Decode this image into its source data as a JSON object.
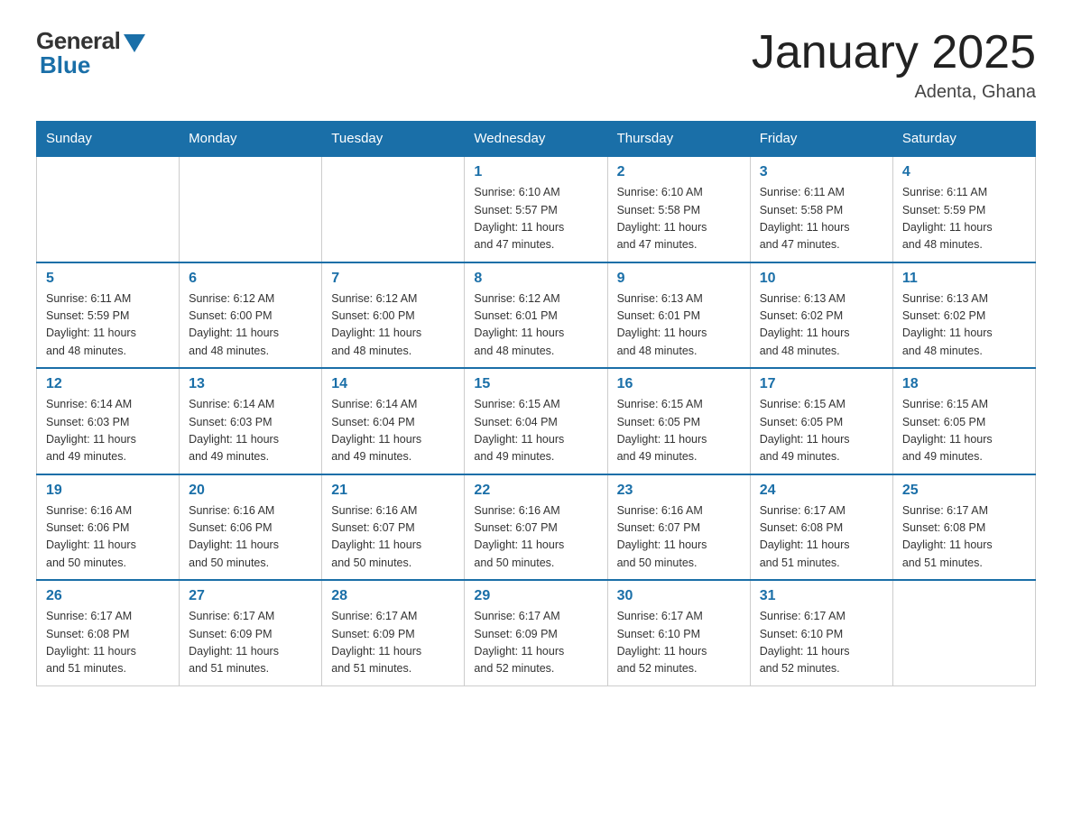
{
  "header": {
    "logo_general": "General",
    "logo_blue": "Blue",
    "month_title": "January 2025",
    "location": "Adenta, Ghana"
  },
  "weekdays": [
    "Sunday",
    "Monday",
    "Tuesday",
    "Wednesday",
    "Thursday",
    "Friday",
    "Saturday"
  ],
  "weeks": [
    [
      {
        "day": "",
        "info": ""
      },
      {
        "day": "",
        "info": ""
      },
      {
        "day": "",
        "info": ""
      },
      {
        "day": "1",
        "info": "Sunrise: 6:10 AM\nSunset: 5:57 PM\nDaylight: 11 hours\nand 47 minutes."
      },
      {
        "day": "2",
        "info": "Sunrise: 6:10 AM\nSunset: 5:58 PM\nDaylight: 11 hours\nand 47 minutes."
      },
      {
        "day": "3",
        "info": "Sunrise: 6:11 AM\nSunset: 5:58 PM\nDaylight: 11 hours\nand 47 minutes."
      },
      {
        "day": "4",
        "info": "Sunrise: 6:11 AM\nSunset: 5:59 PM\nDaylight: 11 hours\nand 48 minutes."
      }
    ],
    [
      {
        "day": "5",
        "info": "Sunrise: 6:11 AM\nSunset: 5:59 PM\nDaylight: 11 hours\nand 48 minutes."
      },
      {
        "day": "6",
        "info": "Sunrise: 6:12 AM\nSunset: 6:00 PM\nDaylight: 11 hours\nand 48 minutes."
      },
      {
        "day": "7",
        "info": "Sunrise: 6:12 AM\nSunset: 6:00 PM\nDaylight: 11 hours\nand 48 minutes."
      },
      {
        "day": "8",
        "info": "Sunrise: 6:12 AM\nSunset: 6:01 PM\nDaylight: 11 hours\nand 48 minutes."
      },
      {
        "day": "9",
        "info": "Sunrise: 6:13 AM\nSunset: 6:01 PM\nDaylight: 11 hours\nand 48 minutes."
      },
      {
        "day": "10",
        "info": "Sunrise: 6:13 AM\nSunset: 6:02 PM\nDaylight: 11 hours\nand 48 minutes."
      },
      {
        "day": "11",
        "info": "Sunrise: 6:13 AM\nSunset: 6:02 PM\nDaylight: 11 hours\nand 48 minutes."
      }
    ],
    [
      {
        "day": "12",
        "info": "Sunrise: 6:14 AM\nSunset: 6:03 PM\nDaylight: 11 hours\nand 49 minutes."
      },
      {
        "day": "13",
        "info": "Sunrise: 6:14 AM\nSunset: 6:03 PM\nDaylight: 11 hours\nand 49 minutes."
      },
      {
        "day": "14",
        "info": "Sunrise: 6:14 AM\nSunset: 6:04 PM\nDaylight: 11 hours\nand 49 minutes."
      },
      {
        "day": "15",
        "info": "Sunrise: 6:15 AM\nSunset: 6:04 PM\nDaylight: 11 hours\nand 49 minutes."
      },
      {
        "day": "16",
        "info": "Sunrise: 6:15 AM\nSunset: 6:05 PM\nDaylight: 11 hours\nand 49 minutes."
      },
      {
        "day": "17",
        "info": "Sunrise: 6:15 AM\nSunset: 6:05 PM\nDaylight: 11 hours\nand 49 minutes."
      },
      {
        "day": "18",
        "info": "Sunrise: 6:15 AM\nSunset: 6:05 PM\nDaylight: 11 hours\nand 49 minutes."
      }
    ],
    [
      {
        "day": "19",
        "info": "Sunrise: 6:16 AM\nSunset: 6:06 PM\nDaylight: 11 hours\nand 50 minutes."
      },
      {
        "day": "20",
        "info": "Sunrise: 6:16 AM\nSunset: 6:06 PM\nDaylight: 11 hours\nand 50 minutes."
      },
      {
        "day": "21",
        "info": "Sunrise: 6:16 AM\nSunset: 6:07 PM\nDaylight: 11 hours\nand 50 minutes."
      },
      {
        "day": "22",
        "info": "Sunrise: 6:16 AM\nSunset: 6:07 PM\nDaylight: 11 hours\nand 50 minutes."
      },
      {
        "day": "23",
        "info": "Sunrise: 6:16 AM\nSunset: 6:07 PM\nDaylight: 11 hours\nand 50 minutes."
      },
      {
        "day": "24",
        "info": "Sunrise: 6:17 AM\nSunset: 6:08 PM\nDaylight: 11 hours\nand 51 minutes."
      },
      {
        "day": "25",
        "info": "Sunrise: 6:17 AM\nSunset: 6:08 PM\nDaylight: 11 hours\nand 51 minutes."
      }
    ],
    [
      {
        "day": "26",
        "info": "Sunrise: 6:17 AM\nSunset: 6:08 PM\nDaylight: 11 hours\nand 51 minutes."
      },
      {
        "day": "27",
        "info": "Sunrise: 6:17 AM\nSunset: 6:09 PM\nDaylight: 11 hours\nand 51 minutes."
      },
      {
        "day": "28",
        "info": "Sunrise: 6:17 AM\nSunset: 6:09 PM\nDaylight: 11 hours\nand 51 minutes."
      },
      {
        "day": "29",
        "info": "Sunrise: 6:17 AM\nSunset: 6:09 PM\nDaylight: 11 hours\nand 52 minutes."
      },
      {
        "day": "30",
        "info": "Sunrise: 6:17 AM\nSunset: 6:10 PM\nDaylight: 11 hours\nand 52 minutes."
      },
      {
        "day": "31",
        "info": "Sunrise: 6:17 AM\nSunset: 6:10 PM\nDaylight: 11 hours\nand 52 minutes."
      },
      {
        "day": "",
        "info": ""
      }
    ]
  ]
}
